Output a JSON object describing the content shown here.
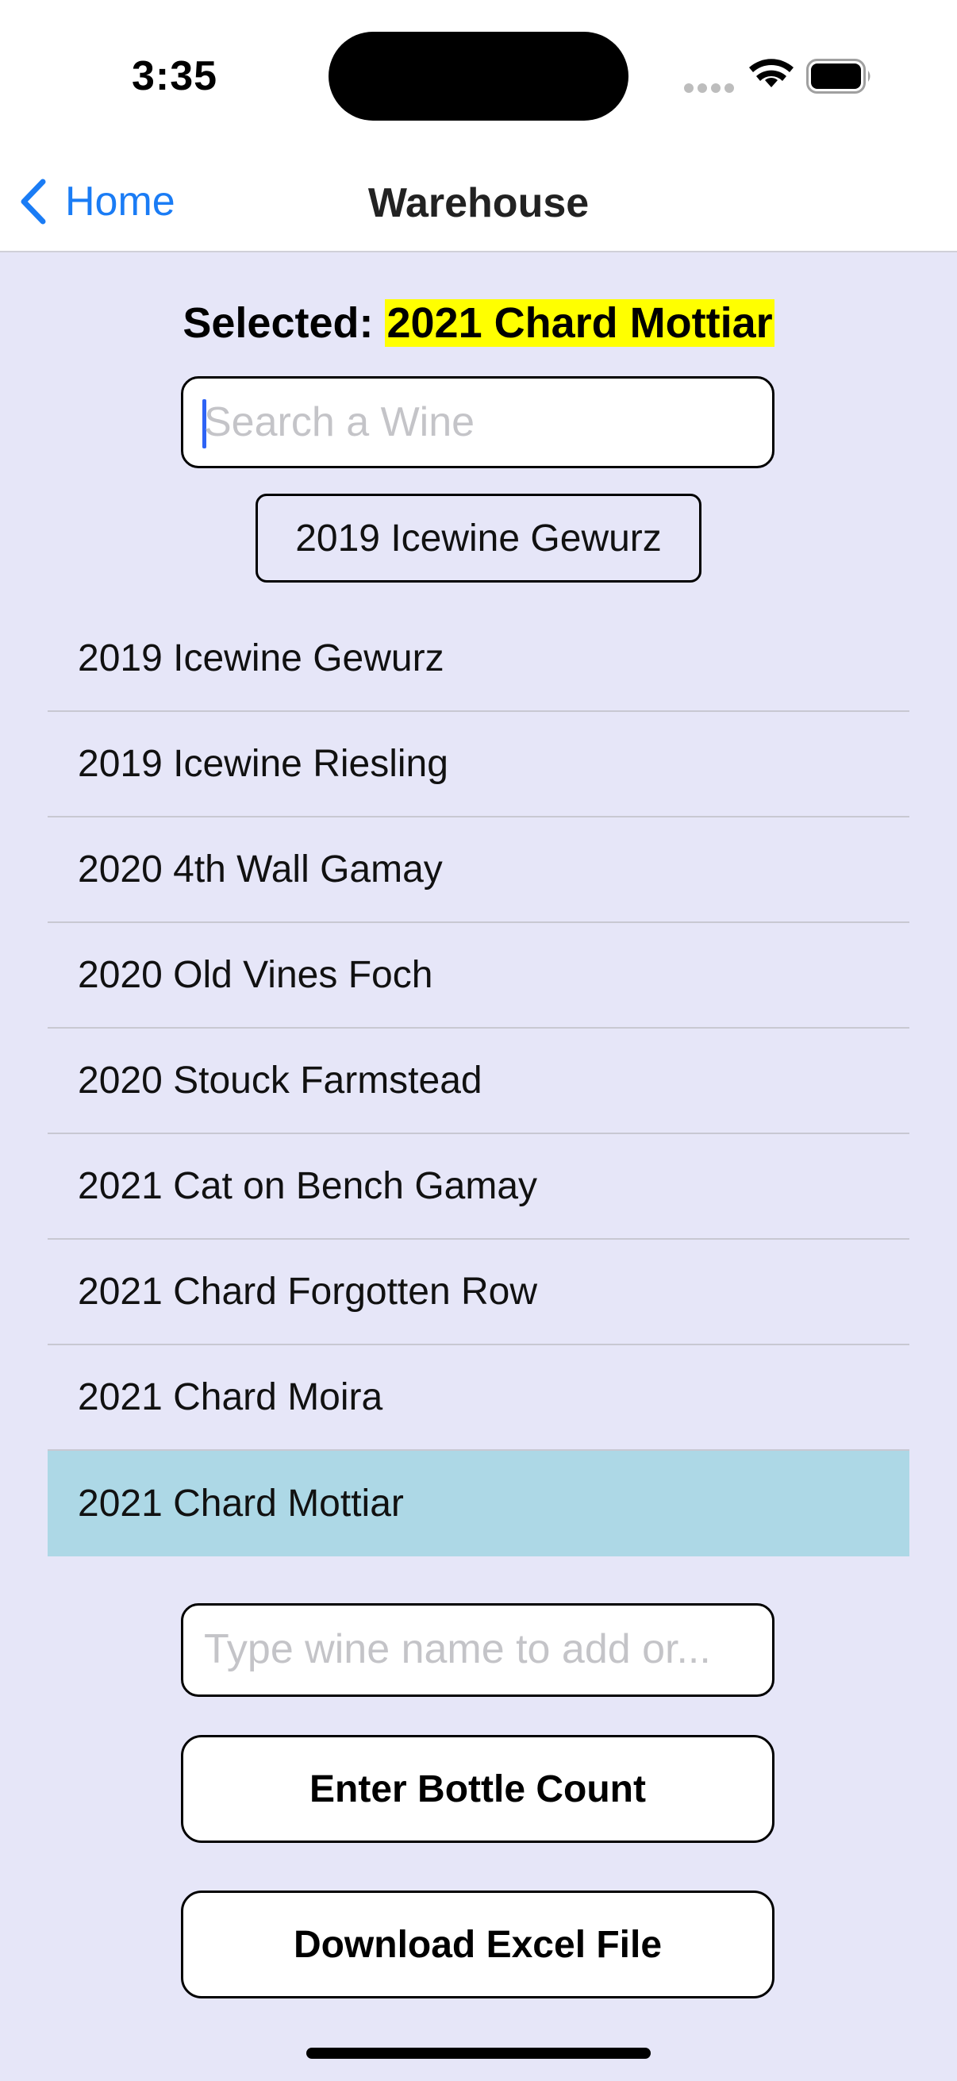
{
  "status_bar": {
    "time": "3:35",
    "icons": [
      "signal-dots-icon",
      "wifi-icon",
      "battery-icon"
    ]
  },
  "nav": {
    "back_label": "Home",
    "title": "Warehouse"
  },
  "selected": {
    "label": "Selected: ",
    "value": "2021 Chard Mottiar",
    "highlight_color": "#FFFF00"
  },
  "search": {
    "placeholder": "Search a Wine",
    "value": ""
  },
  "suggestion_chip": "2019 Icewine Gewurz",
  "wines": [
    "2019 Icewine Gewurz",
    "2019 Icewine Riesling",
    "2020 4th Wall Gamay",
    "2020 Old Vines Foch",
    "2020 Stouck Farmstead",
    "2021 Cat on Bench Gamay",
    "2021 Chard Forgotten Row",
    "2021 Chard Moira",
    "2021 Chard Mottiar"
  ],
  "selected_row_color": "#ADD8E6",
  "add_wine": {
    "placeholder": "Type wine name to add or..."
  },
  "buttons": {
    "bottle_count": "Enter Bottle Count",
    "download_excel": "Download Excel File"
  },
  "colors": {
    "background": "#E6E6F8",
    "accent": "#1A7CF5"
  }
}
